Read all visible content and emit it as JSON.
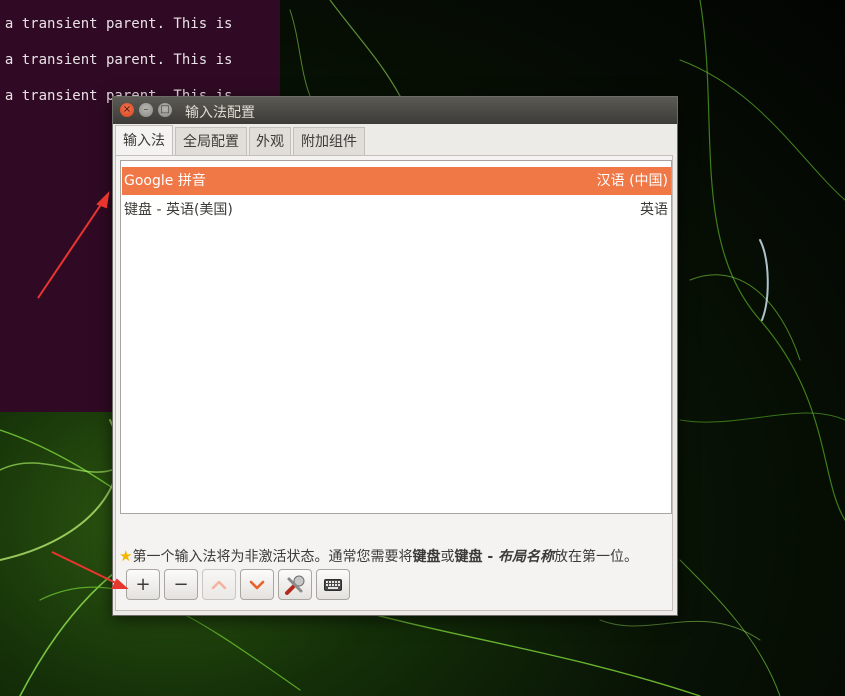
{
  "terminal": {
    "lines": [
      "t a transient parent. This is",
      "t a transient parent. This is",
      "t a transient parent. This is"
    ]
  },
  "window": {
    "title": "输入法配置",
    "controls": {
      "close": "×",
      "minimize": "–",
      "maximize": "□"
    }
  },
  "tabs": [
    {
      "label": "输入法",
      "active": true
    },
    {
      "label": "全局配置",
      "active": false
    },
    {
      "label": "外观",
      "active": false
    },
    {
      "label": "附加组件",
      "active": false
    }
  ],
  "input_methods": [
    {
      "name": "Google 拼音",
      "language": "汉语 (中国)",
      "selected": true
    },
    {
      "name": "键盘 - 英语(美国)",
      "language": "英语",
      "selected": false
    }
  ],
  "hint": {
    "icon": "star-icon",
    "part1": "第一个输入法将为非激活状态。通常您需要将",
    "bold1": "键盘",
    "part2": "或",
    "bold2": "键盘 - ",
    "bold_italic": "布局名称",
    "part3": "放在第一位。"
  },
  "toolbar": {
    "add": "+",
    "remove": "−",
    "move_up": "︿",
    "move_down": "﹀",
    "configure_icon": "settings-tool-icon",
    "keyboard_icon": "keyboard-icon"
  },
  "colors": {
    "selection": "#f07746",
    "titlebar": "#3c3b37",
    "terminal": "#300a24",
    "annotation_arrow": "#e8362e"
  }
}
